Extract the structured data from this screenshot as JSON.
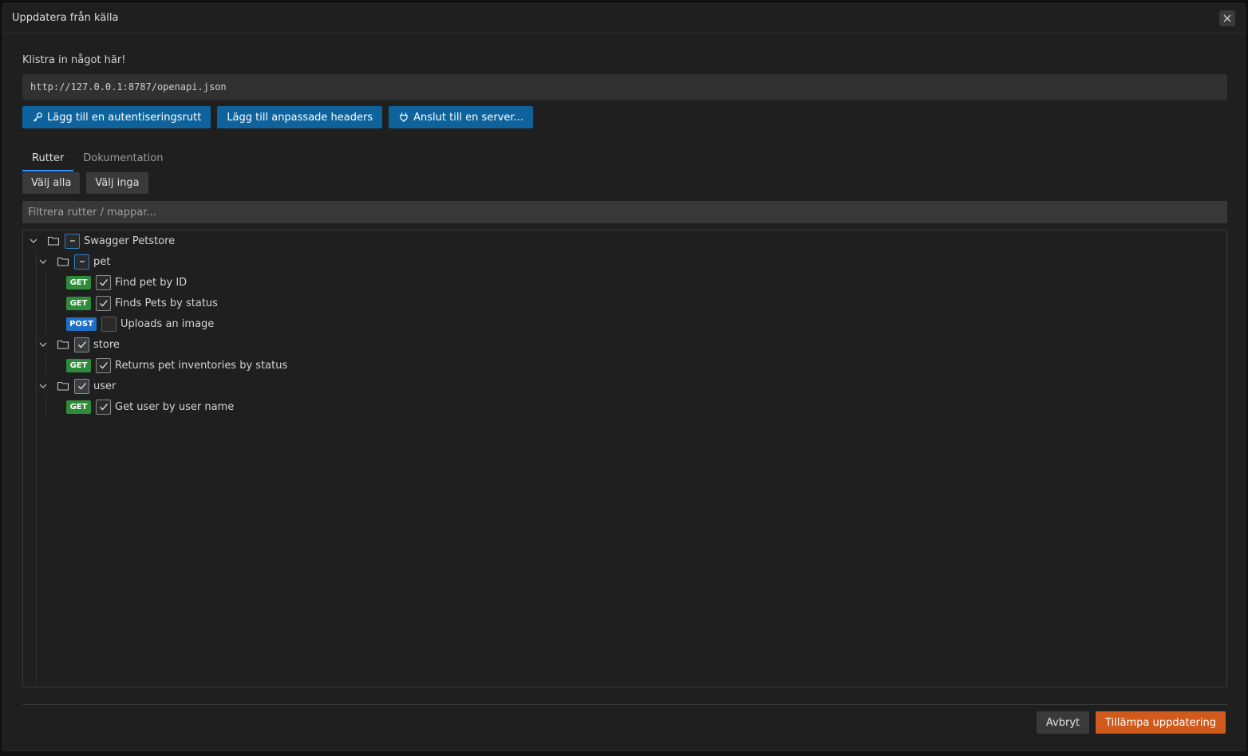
{
  "dialog": {
    "title": "Uppdatera från källa",
    "paste_label": "Klistra in något här!",
    "url_value": "http://127.0.0.1:8787/openapi.json"
  },
  "actions": {
    "auth_route": "Lägg till en autentiseringsrutt",
    "custom_headers": "Lägg till anpassade headers",
    "connect_server": "Anslut till en server..."
  },
  "tabs": [
    {
      "label": "Rutter",
      "active": true
    },
    {
      "label": "Dokumentation",
      "active": false
    }
  ],
  "selection": {
    "select_all": "Välj alla",
    "select_none": "Välj inga"
  },
  "filter": {
    "placeholder": "Filtrera rutter / mappar..."
  },
  "tree": {
    "root": {
      "label": "Swagger Petstore",
      "state": "partial"
    },
    "folders": [
      {
        "label": "pet",
        "state": "partial",
        "routes": [
          {
            "method": "GET",
            "label": "Find pet by ID",
            "checked": true
          },
          {
            "method": "GET",
            "label": "Finds Pets by status",
            "checked": true
          },
          {
            "method": "POST",
            "label": "Uploads an image",
            "checked": false
          }
        ]
      },
      {
        "label": "store",
        "state": "checked",
        "routes": [
          {
            "method": "GET",
            "label": "Returns pet inventories by status",
            "checked": true
          }
        ]
      },
      {
        "label": "user",
        "state": "checked",
        "routes": [
          {
            "method": "GET",
            "label": "Get user by user name",
            "checked": true
          }
        ]
      }
    ]
  },
  "footer": {
    "cancel": "Avbryt",
    "apply": "Tillämpa uppdatering"
  },
  "colors": {
    "primary_button": "#0e639c",
    "apply_button": "#d0591c",
    "get_badge": "#2e8b3a",
    "post_badge": "#1f6fc5"
  }
}
